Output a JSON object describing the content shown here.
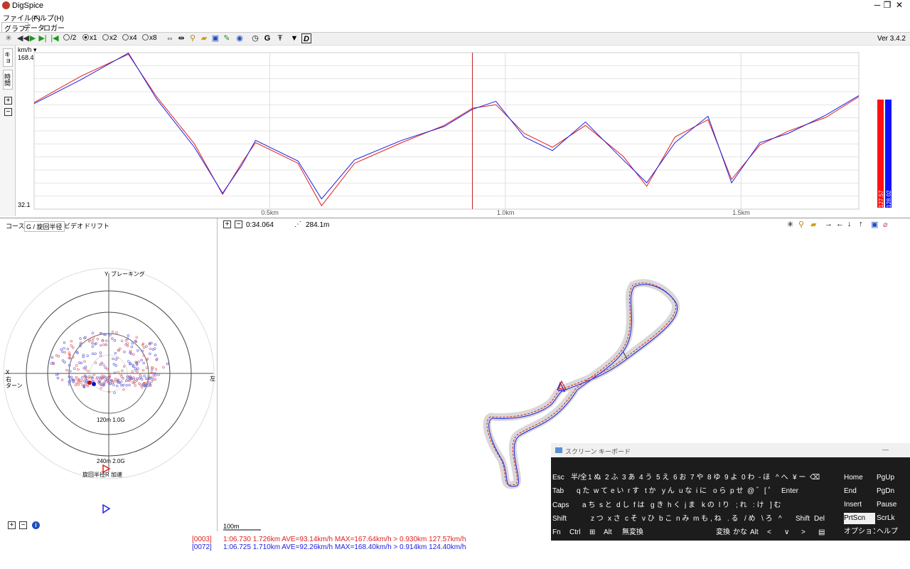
{
  "window": {
    "title": "DigSpice",
    "minimize": "─",
    "maximize": "❐",
    "close": "✕"
  },
  "menu": [
    {
      "label": "ファイル(F)"
    },
    {
      "label": "ヘルプ(H)"
    }
  ],
  "main_tabs": [
    {
      "label": "グラフ"
    },
    {
      "label": "データ"
    },
    {
      "label": "ロガー"
    }
  ],
  "toolbar": {
    "radios": [
      {
        "label": "/2",
        "on": false
      },
      {
        "label": "x1",
        "on": true
      },
      {
        "label": "x2",
        "on": false
      },
      {
        "label": "x4",
        "on": false
      },
      {
        "label": "x8",
        "on": false
      }
    ],
    "version": "Ver 3.4.2"
  },
  "graph": {
    "unit": "km/h ▾",
    "side_tabs": [
      {
        "label": "キョリ"
      },
      {
        "label": "時間"
      }
    ],
    "ymax": "168.4",
    "ymin": "32.1",
    "xticks": [
      {
        "label": "0.5km"
      },
      {
        "label": "1.0km"
      },
      {
        "label": "1.5km"
      }
    ],
    "bar_red_label": "127.57",
    "bar_blue_label": "128.02",
    "colors": {
      "red": "#e02020",
      "blue": "#2020e0",
      "cursor": "#c02020"
    },
    "chart_data": {
      "type": "line",
      "xlabel": "",
      "ylabel": "km/h",
      "ylim": [
        32.1,
        168.4
      ],
      "xlim": [
        0,
        1.75
      ],
      "cursor_x": 0.93,
      "series": [
        {
          "color": "#e02020",
          "x": [
            0,
            0.1,
            0.2,
            0.26,
            0.34,
            0.4,
            0.44,
            0.47,
            0.56,
            0.61,
            0.68,
            0.78,
            0.87,
            0.93,
            0.98,
            1.04,
            1.1,
            1.17,
            1.25,
            1.3,
            1.36,
            1.43,
            1.48,
            1.54,
            1.6,
            1.68,
            1.75
          ],
          "y": [
            125,
            148,
            167,
            130,
            89,
            45,
            72,
            90,
            72,
            35,
            72,
            90,
            105,
            120,
            123,
            98,
            86,
            105,
            78,
            52,
            95,
            110,
            58,
            88,
            100,
            112,
            130
          ]
        },
        {
          "color": "#2020e0",
          "x": [
            0,
            0.1,
            0.2,
            0.26,
            0.34,
            0.4,
            0.44,
            0.47,
            0.56,
            0.61,
            0.68,
            0.78,
            0.87,
            0.93,
            0.98,
            1.04,
            1.1,
            1.17,
            1.25,
            1.3,
            1.36,
            1.43,
            1.48,
            1.54,
            1.6,
            1.68,
            1.75
          ],
          "y": [
            124,
            145,
            168,
            128,
            86,
            46,
            70,
            92,
            74,
            41,
            75,
            92,
            104,
            119,
            126,
            95,
            83,
            108,
            75,
            55,
            90,
            113,
            55,
            90,
            98,
            114,
            131
          ]
        }
      ]
    }
  },
  "gpanel": {
    "tabs": [
      {
        "label": "コース"
      },
      {
        "label": "G / 旋回半径"
      },
      {
        "label": "ビデオ"
      },
      {
        "label": "ドリフト"
      }
    ],
    "label_y": "Y",
    "label_braking": "ブレーキング",
    "label_x": "X",
    "label_right": "右",
    "label_turn": "ターン",
    "label_left": "左",
    "ring1": "120m  1.0G",
    "ring2": "240m  2.0G",
    "label_radius": "旋回半径R",
    "label_accel": "加速"
  },
  "map": {
    "time": "0:34.064",
    "distance": "284.1m",
    "scale": "100m",
    "toolbar_icons": [
      {
        "name": "sparkle-icon",
        "glyph": "✳"
      },
      {
        "name": "zoom-icon",
        "glyph": "🔍"
      },
      {
        "name": "folder-icon",
        "glyph": "📂"
      },
      {
        "name": "arrow-right-icon",
        "glyph": "→"
      },
      {
        "name": "arrow-left-icon",
        "glyph": "←"
      },
      {
        "name": "arrow-down-icon",
        "glyph": "↓"
      },
      {
        "name": "arrow-up-icon",
        "glyph": "↑"
      },
      {
        "name": "save-icon",
        "glyph": "💾"
      },
      {
        "name": "eraser-icon",
        "glyph": "⌀"
      }
    ]
  },
  "footer": {
    "lap1_id": "[0003]",
    "lap1_text": "1:06.730 1.726km AVE=93.14km/h MAX=167.64km/h > 0.930km 127.57km/h",
    "lap2_id": "[0072]",
    "lap2_text": "1:06.725 1.710km AVE=92.26km/h MAX=168.40km/h > 0.914km 124.40km/h"
  },
  "keyboard": {
    "title": "スクリーン キーボード",
    "min": "—",
    "row1": [
      {
        "l": "Esc"
      },
      {
        "l": "半/全"
      },
      {
        "l": "1 ぬ"
      },
      {
        "l": "2 ふ"
      },
      {
        "l": "3 あ"
      },
      {
        "l": "4 う"
      },
      {
        "l": "5 え"
      },
      {
        "l": "6 お"
      },
      {
        "l": "7 や"
      },
      {
        "l": "8 ゆ"
      },
      {
        "l": "9 よ"
      },
      {
        "l": "0 わ"
      },
      {
        "l": "- ほ"
      },
      {
        "l": "^ へ"
      },
      {
        "l": "¥ ー"
      },
      {
        "l": "⌫"
      }
    ],
    "row2": [
      {
        "l": "Tab"
      },
      {
        "l": "q た"
      },
      {
        "l": "w て"
      },
      {
        "l": "e い"
      },
      {
        "l": "r す"
      },
      {
        "l": "t か"
      },
      {
        "l": "y ん"
      },
      {
        "l": "u な"
      },
      {
        "l": "i に"
      },
      {
        "l": "o ら"
      },
      {
        "l": "p せ"
      },
      {
        "l": "@ ゛"
      },
      {
        "l": "[ ゜"
      },
      {
        "l": "Enter"
      }
    ],
    "row3": [
      {
        "l": "Caps"
      },
      {
        "l": "a ち"
      },
      {
        "l": "s と"
      },
      {
        "l": "d し"
      },
      {
        "l": "f は"
      },
      {
        "l": "g き"
      },
      {
        "l": "h く"
      },
      {
        "l": "j ま"
      },
      {
        "l": "k の"
      },
      {
        "l": "l り"
      },
      {
        "l": "; れ"
      },
      {
        "l": ": け"
      },
      {
        "l": "] む"
      }
    ],
    "row4": [
      {
        "l": "Shift"
      },
      {
        "l": "z つ"
      },
      {
        "l": "x さ"
      },
      {
        "l": "c そ"
      },
      {
        "l": "v ひ"
      },
      {
        "l": "b こ"
      },
      {
        "l": "n み"
      },
      {
        "l": "m も"
      },
      {
        "l": ", ね"
      },
      {
        "l": ". る"
      },
      {
        "l": "/ め"
      },
      {
        "l": "\\ ろ"
      },
      {
        "l": "^"
      },
      {
        "l": "Shift"
      },
      {
        "l": "Del"
      }
    ],
    "row5": [
      {
        "l": "Fn"
      },
      {
        "l": "Ctrl"
      },
      {
        "l": "⊞"
      },
      {
        "l": "Alt"
      },
      {
        "l": "無変換"
      },
      {
        "l": " "
      },
      {
        "l": "変換"
      },
      {
        "l": "かな"
      },
      {
        "l": "Alt"
      },
      {
        "l": "<"
      },
      {
        "l": "∨"
      },
      {
        "l": ">"
      },
      {
        "l": "▤"
      }
    ],
    "nav": [
      {
        "l": "Home"
      },
      {
        "l": "PgUp"
      },
      {
        "l": "End"
      },
      {
        "l": "PgDn"
      },
      {
        "l": "Insert"
      },
      {
        "l": "Pause"
      },
      {
        "l": "PrtScn"
      },
      {
        "l": "ScrLk"
      },
      {
        "l": "オプション"
      },
      {
        "l": "ヘルプ"
      }
    ]
  }
}
